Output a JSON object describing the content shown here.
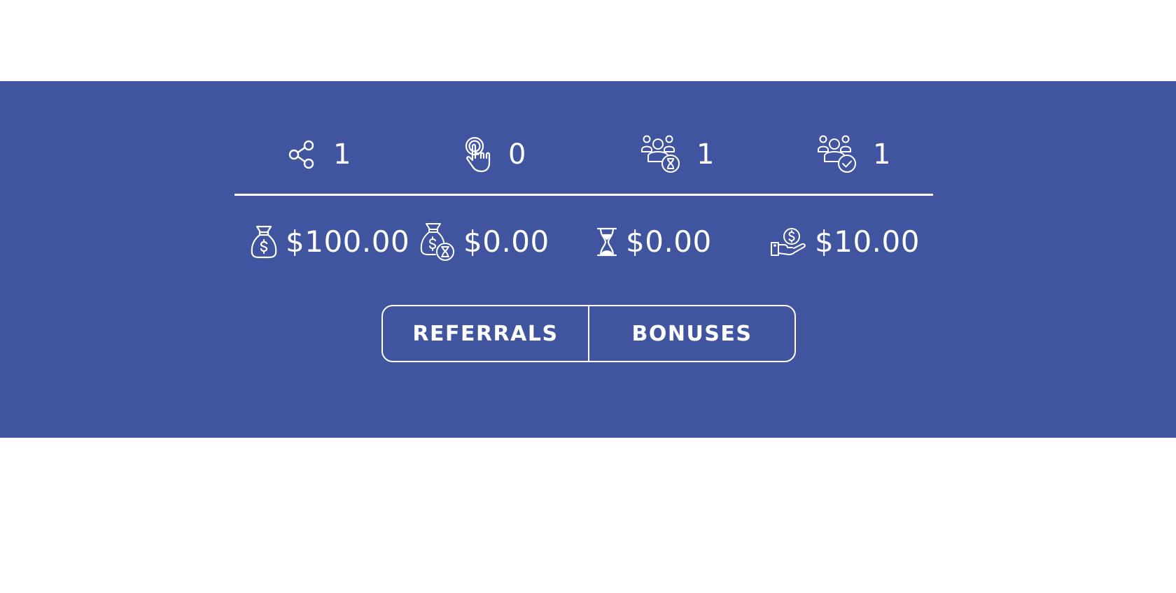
{
  "colors": {
    "panel_background": "#40549f",
    "foreground": "#ffffff",
    "page_background": "#ffffff"
  },
  "stats_counts": [
    {
      "icon": "share-icon",
      "value": "1"
    },
    {
      "icon": "click-pointer-icon",
      "value": "0"
    },
    {
      "icon": "users-pending-icon",
      "value": "1"
    },
    {
      "icon": "users-approved-icon",
      "value": "1"
    }
  ],
  "stats_amounts": [
    {
      "icon": "money-bag-icon",
      "value": "$100.00"
    },
    {
      "icon": "money-bag-pending-icon",
      "value": "$0.00"
    },
    {
      "icon": "hourglass-icon",
      "value": "$0.00"
    },
    {
      "icon": "hand-coin-icon",
      "value": "$10.00"
    }
  ],
  "tabs": {
    "referrals_label": "REFERRALS",
    "bonuses_label": "BONUSES"
  }
}
